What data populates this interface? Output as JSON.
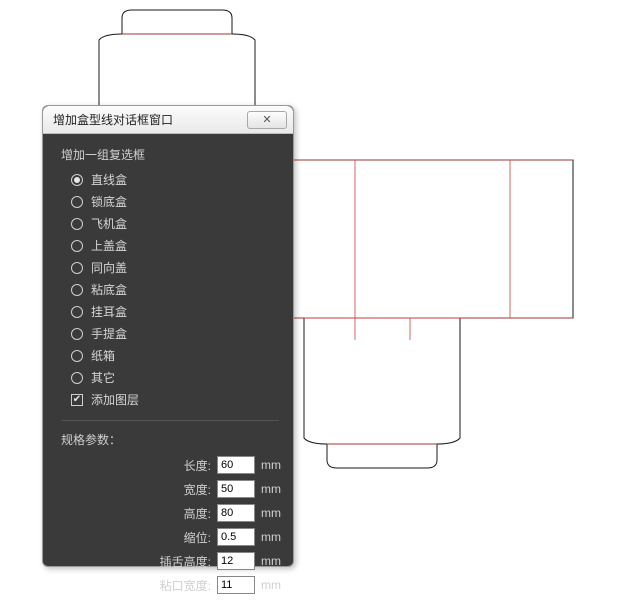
{
  "dialog": {
    "title": "增加盒型线对话框窗口",
    "close_symbol": "✕",
    "group_label": "增加一组复选框",
    "options": [
      {
        "label": "直线盒",
        "checked": true
      },
      {
        "label": "锁底盒",
        "checked": false
      },
      {
        "label": "飞机盒",
        "checked": false
      },
      {
        "label": "上盖盒",
        "checked": false
      },
      {
        "label": "同向盖",
        "checked": false
      },
      {
        "label": "粘底盒",
        "checked": false
      },
      {
        "label": "挂耳盒",
        "checked": false
      },
      {
        "label": "手提盒",
        "checked": false
      },
      {
        "label": "纸箱",
        "checked": false
      },
      {
        "label": "其它",
        "checked": false
      }
    ],
    "add_layer": {
      "label": "添加图层",
      "checked": true
    },
    "params_label": "规格参数：",
    "params": {
      "length": {
        "label": "长度:",
        "value": "60",
        "unit": "mm"
      },
      "width": {
        "label": "宽度:",
        "value": "50",
        "unit": "mm"
      },
      "height": {
        "label": "高度:",
        "value": "80",
        "unit": "mm"
      },
      "indent": {
        "label": "缩位:",
        "value": "0.5",
        "unit": "mm"
      },
      "tongue": {
        "label": "插舌高度:",
        "value": "12",
        "unit": "mm"
      },
      "glue": {
        "label": "粘口宽度:",
        "value": "11",
        "unit": "mm"
      }
    }
  },
  "drawing": {
    "stroke_outline": "#1a1a1a",
    "stroke_fold": "#d14040"
  }
}
